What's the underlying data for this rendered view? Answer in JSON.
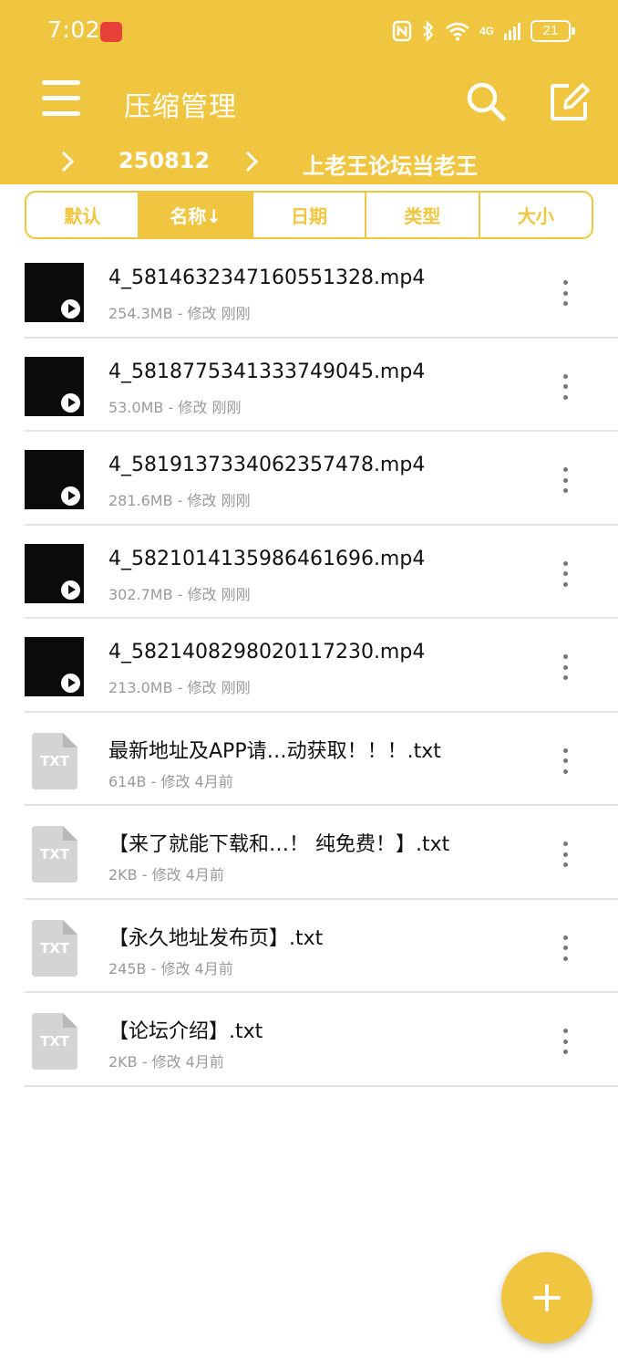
{
  "status_bar": {
    "time": "7:02",
    "network": "4G",
    "battery": "21"
  },
  "toolbar": {
    "title": "压缩管理",
    "menu_icon": "hamburger-menu-icon",
    "search_icon": "search-icon",
    "edit_icon": "edit-icon"
  },
  "breadcrumb": {
    "items": [
      "250812",
      "上老王论坛当老王"
    ]
  },
  "sort_tabs": [
    {
      "label": "默认",
      "active": false
    },
    {
      "label": "名称↓",
      "active": true
    },
    {
      "label": "日期",
      "active": false
    },
    {
      "label": "类型",
      "active": false
    },
    {
      "label": "大小",
      "active": false
    }
  ],
  "files": [
    {
      "name": "4_5814632347160551328.mp4",
      "meta": "254.3MB - 修改 刚刚",
      "type": "video"
    },
    {
      "name": "4_5818775341333749045.mp4",
      "meta": "53.0MB - 修改 刚刚",
      "type": "video"
    },
    {
      "name": "4_5819137334062357478.mp4",
      "meta": "281.6MB - 修改 刚刚",
      "type": "video"
    },
    {
      "name": "4_5821014135986461696.mp4",
      "meta": "302.7MB - 修改 刚刚",
      "type": "video"
    },
    {
      "name": "4_5821408298020117230.mp4",
      "meta": "213.0MB - 修改 刚刚",
      "type": "video"
    },
    {
      "name": "最新地址及APP请…动获取！！！.txt",
      "meta": "614B - 修改 4月前",
      "type": "txt"
    },
    {
      "name": "【来了就能下载和…！ 纯免费！】.txt",
      "meta": "2KB - 修改 4月前",
      "type": "txt"
    },
    {
      "name": "【永久地址发布页】.txt",
      "meta": "245B - 修改 4月前",
      "type": "txt"
    },
    {
      "name": "【论坛介绍】.txt",
      "meta": "2KB - 修改 4月前",
      "type": "txt"
    }
  ],
  "txt_icon_label": "TXT",
  "fab": {
    "icon": "plus-icon"
  },
  "colors": {
    "accent": "#f0c640",
    "divider": "#e4e4e4",
    "meta_text": "#9a9a9a"
  }
}
